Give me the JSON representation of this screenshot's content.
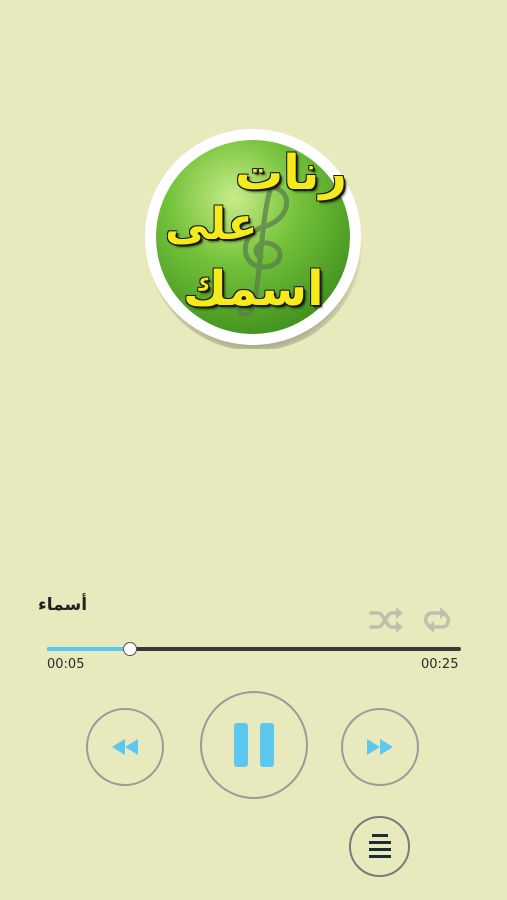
{
  "logo": {
    "line1": "رنات",
    "line2": "على",
    "line3": "اسمك"
  },
  "player": {
    "track_title": "أسماء",
    "current_time": "00:05",
    "total_time": "00:25",
    "progress": 0.2,
    "state": "playing"
  },
  "icons": {
    "shuffle": "shuffle-icon",
    "repeat": "repeat-icon",
    "rewind": "rewind-icon",
    "pause": "pause-icon",
    "fast_forward": "fast-forward-icon",
    "playlist": "playlist-icon"
  },
  "colors": {
    "background": "#e8e9bd",
    "accent": "#5cc8f0",
    "logo_green": "#5aa832",
    "logo_text": "#f5ea1c"
  }
}
